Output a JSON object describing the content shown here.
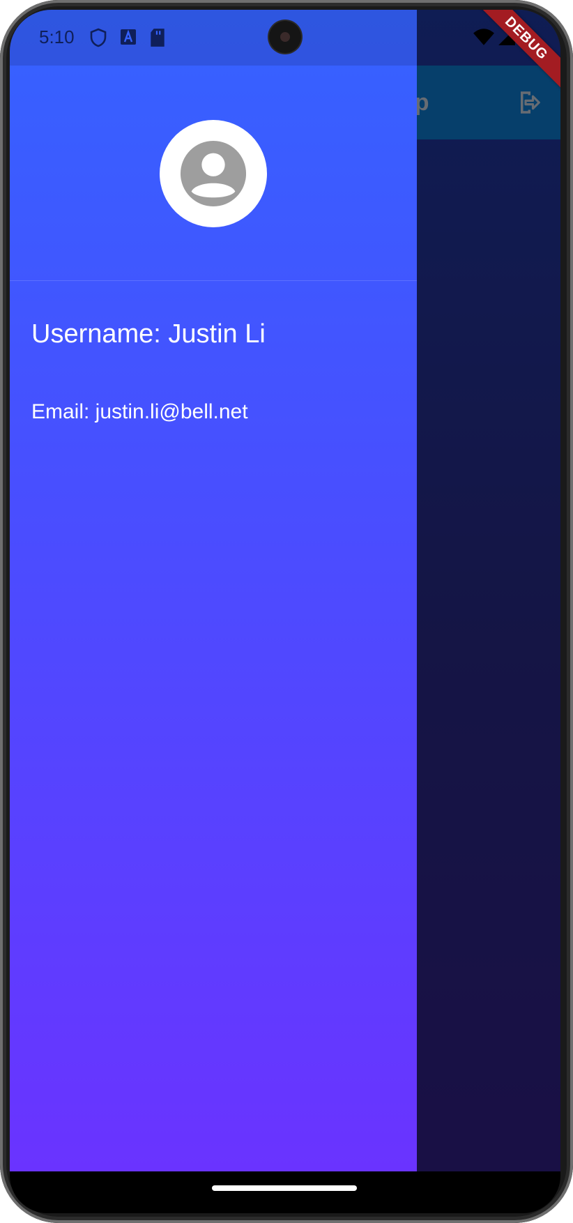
{
  "status_bar": {
    "time": "5:10",
    "left_icons": [
      "shield-icon",
      "font-a-icon",
      "sd-card-icon"
    ],
    "right_icons": [
      "wifi-icon",
      "cell-signal-icon",
      "battery-icon"
    ]
  },
  "debug_banner": {
    "label": "DEBUG"
  },
  "app_bar": {
    "title_partial": "pp",
    "action_icon": "logout-icon"
  },
  "drawer": {
    "avatar_icon": "account-circle-icon",
    "username_line": "Username: Justin Li",
    "email_line": "Email: justin.li@bell.net",
    "colors": {
      "gradient_top": "#3562ff",
      "gradient_bottom": "#6a33ff"
    }
  },
  "nav_bar": {
    "home_indicator": "home-indicator"
  }
}
